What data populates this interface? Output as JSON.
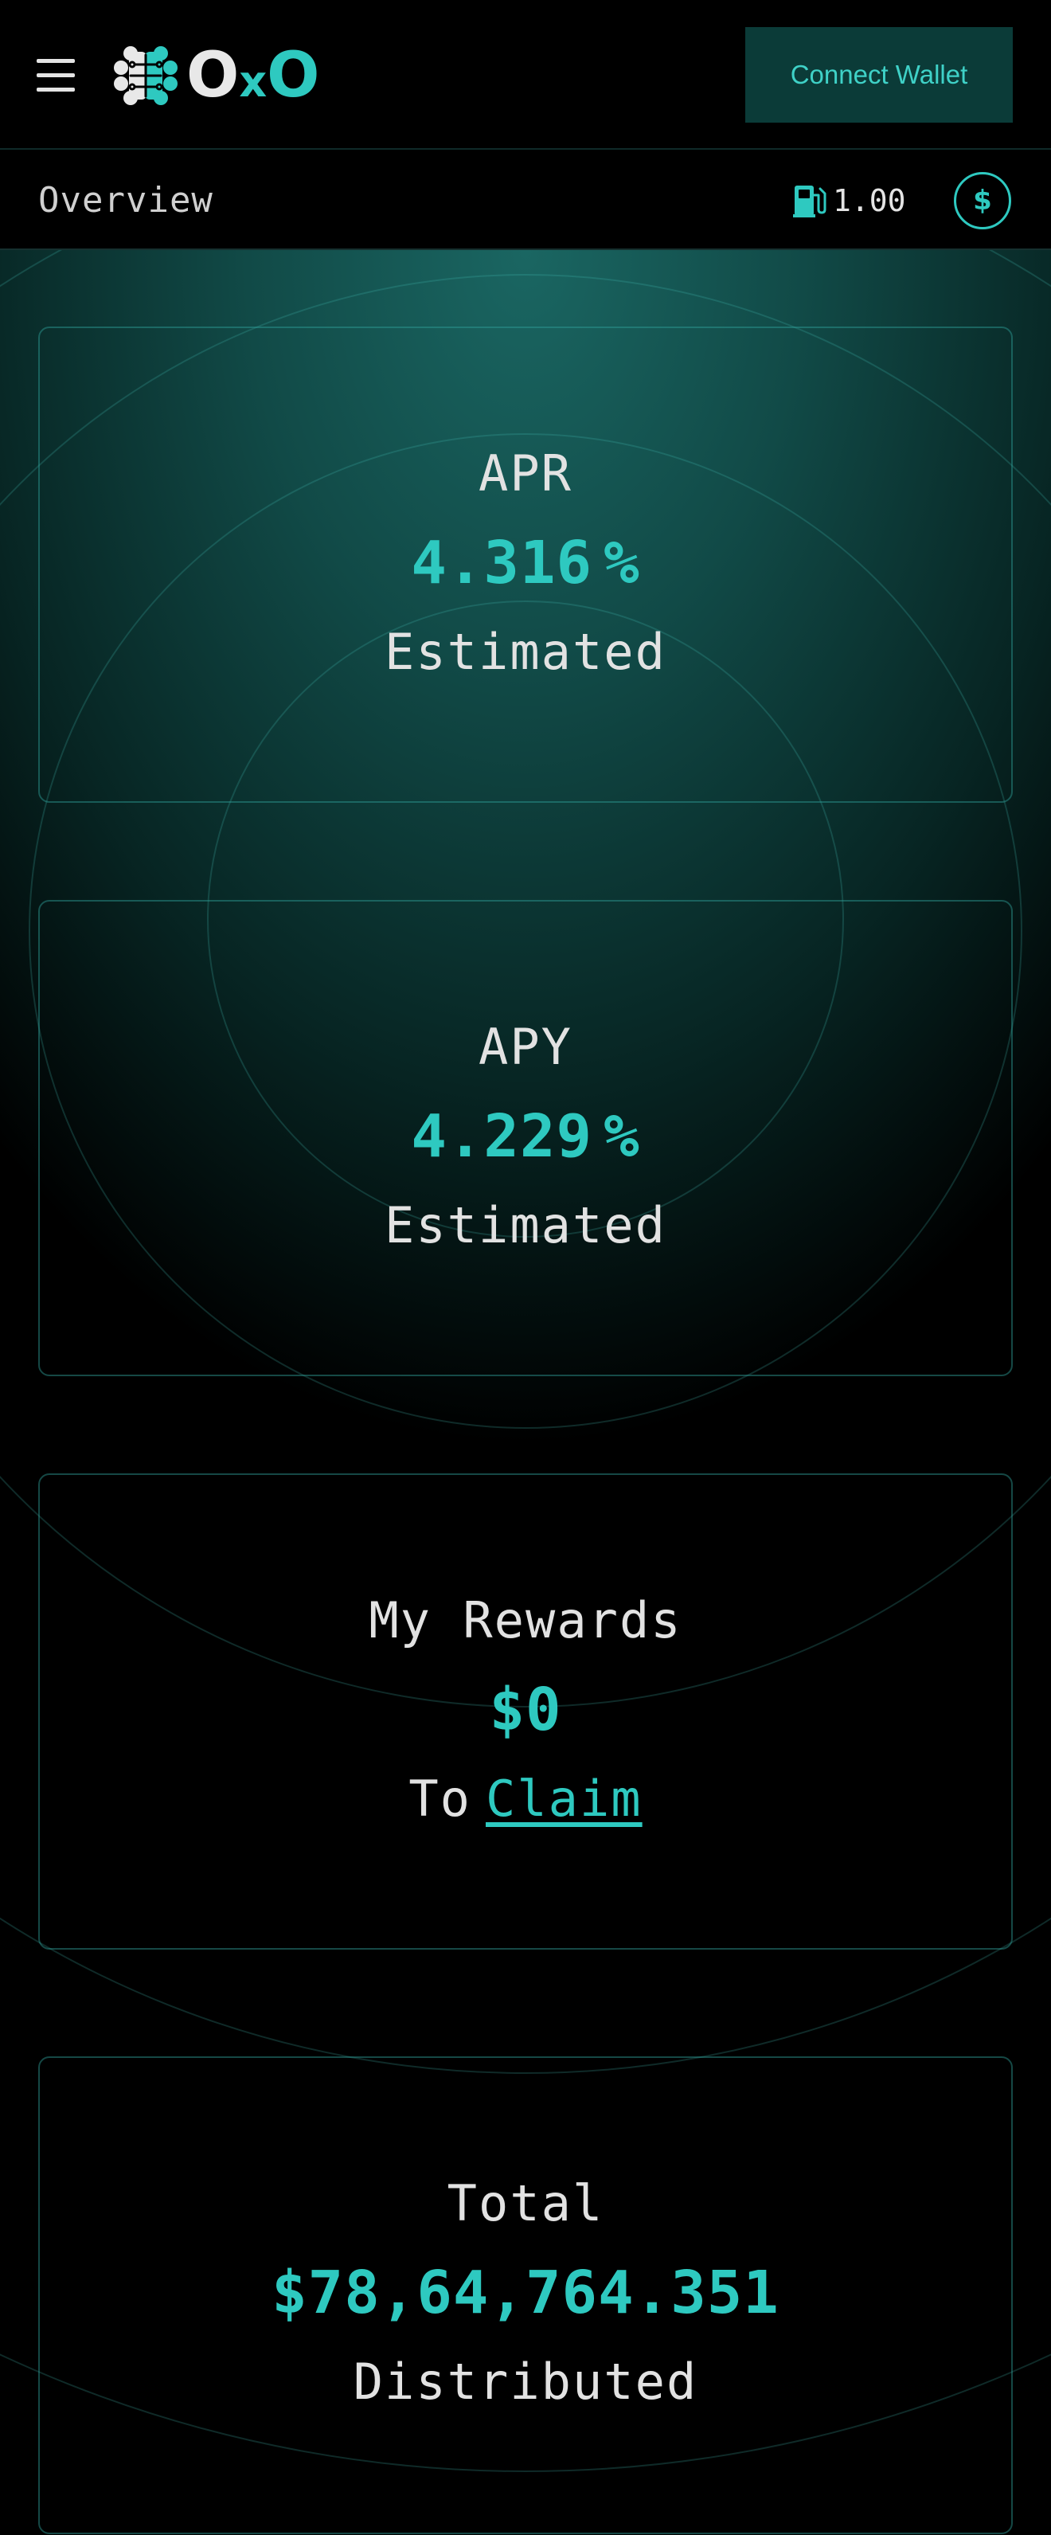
{
  "header": {
    "logo_text_a": "O",
    "logo_text_x": "x",
    "logo_text_b": "O",
    "connect_label": "Connect Wallet"
  },
  "subbar": {
    "title": "Overview",
    "gas_value": "1.00",
    "currency_symbol": "$"
  },
  "colors": {
    "accent": "#2ec9c0",
    "button_bg": "#0b3b38",
    "background": "#000000",
    "text": "#e4e4e4"
  },
  "cards": {
    "apr": {
      "label": "APR",
      "value": "4.316",
      "unit": "%",
      "sub": "Estimated"
    },
    "apy": {
      "label": "APY",
      "value": "4.229",
      "unit": "%",
      "sub": "Estimated"
    },
    "rewards": {
      "label": "My Rewards",
      "value": "$0",
      "sub_prefix": "To",
      "sub_link": "Claim"
    },
    "total": {
      "label": "Total",
      "value": "$78,64,764.351",
      "sub": "Distributed"
    }
  },
  "icons": {
    "menu": "menu-icon",
    "gas": "gas-pump-icon",
    "currency": "dollar-icon",
    "logo": "brain-logo-icon"
  }
}
